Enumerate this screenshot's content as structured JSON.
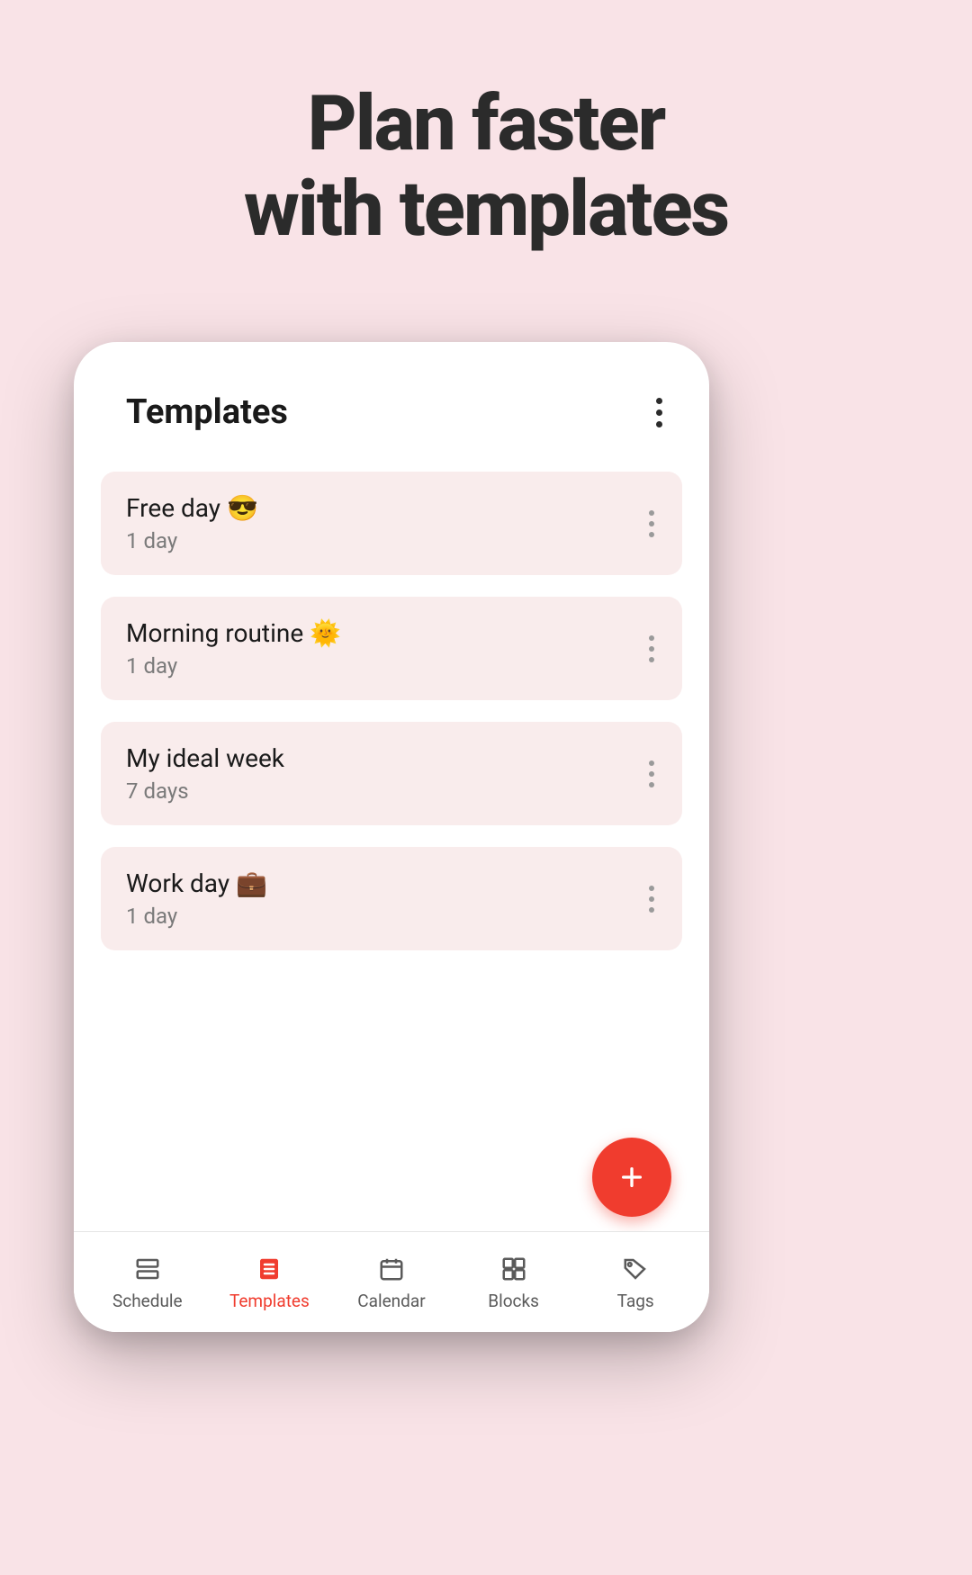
{
  "headline": {
    "line1": "Plan faster",
    "line2": "with templates"
  },
  "header": {
    "title": "Templates"
  },
  "templates": [
    {
      "title": "Free day 😎",
      "subtitle": "1 day"
    },
    {
      "title": "Morning routine 🌞",
      "subtitle": "1 day"
    },
    {
      "title": "My ideal week",
      "subtitle": "7 days"
    },
    {
      "title": "Work day 💼",
      "subtitle": "1 day"
    }
  ],
  "nav": {
    "items": [
      {
        "label": "Schedule",
        "icon": "schedule-icon",
        "active": false
      },
      {
        "label": "Templates",
        "icon": "templates-icon",
        "active": true
      },
      {
        "label": "Calendar",
        "icon": "calendar-icon",
        "active": false
      },
      {
        "label": "Blocks",
        "icon": "blocks-icon",
        "active": false
      },
      {
        "label": "Tags",
        "icon": "tags-icon",
        "active": false
      }
    ]
  },
  "colors": {
    "accent": "#f03c2e",
    "background": "#f9e3e7",
    "cardBg": "#f9ecec"
  }
}
